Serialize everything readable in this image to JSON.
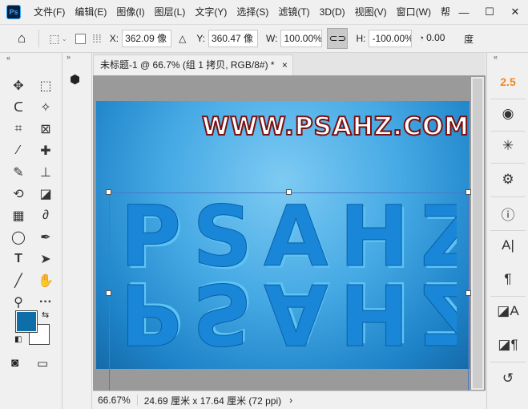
{
  "app": {
    "logo": "Ps"
  },
  "menu": [
    "文件(F)",
    "编辑(E)",
    "图像(I)",
    "图层(L)",
    "文字(Y)",
    "选择(S)",
    "滤镜(T)",
    "3D(D)",
    "视图(V)",
    "窗口(W)",
    "帮"
  ],
  "window_controls": {
    "minimize": "—",
    "maximize": "☐",
    "close": "✕"
  },
  "options": {
    "x_label": "X:",
    "x_value": "362.09 像",
    "y_label": "Y:",
    "y_value": "360.47 像",
    "w_label": "W:",
    "w_value": "100.00%",
    "h_label": "H:",
    "h_value": "-100.00%",
    "angle_value": "0.00",
    "angle_unit": "度"
  },
  "document": {
    "tab_title": "未标题-1 @ 66.7% (组 1 拷贝, RGB/8#) *",
    "tab_close": "×",
    "watermark": "WWW.PSAHZ.COM",
    "art_letters": "PSAHZ"
  },
  "status": {
    "zoom": "66.67%",
    "size": "24.69 厘米 x 17.64 厘米 (72 ppi)",
    "arrow": "›"
  },
  "right_panel": {
    "top_label": "2.5"
  },
  "colors": {
    "foreground": "#0e6fa8",
    "background": "#ffffff",
    "accent_orange": "#f0891c"
  }
}
